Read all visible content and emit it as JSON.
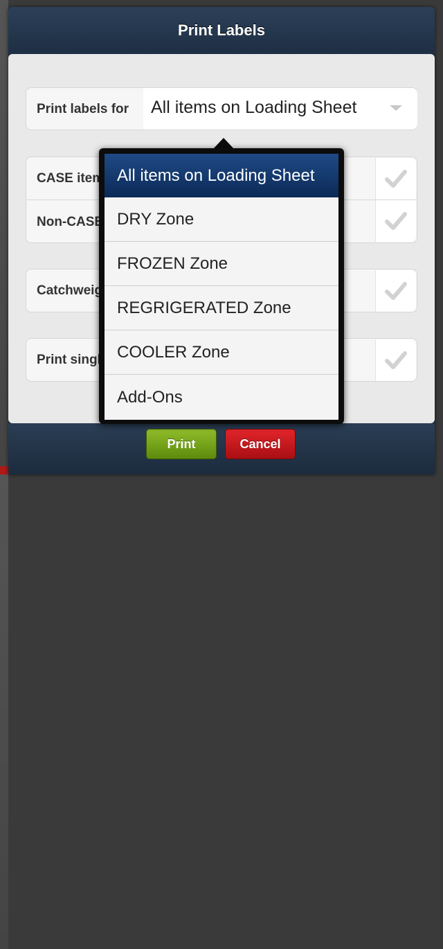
{
  "dialog": {
    "title": "Print Labels"
  },
  "print_for": {
    "label": "Print labels for",
    "value": "All items on Loading Sheet"
  },
  "options": {
    "case_items_label": "CASE item",
    "non_case_label": "Non-CASE",
    "catchweight_label": "Catchweig",
    "print_single_label": "Print singl"
  },
  "dropdown": {
    "items": [
      "All items on Loading Sheet",
      "DRY Zone",
      "FROZEN Zone",
      "REGRIGERATED Zone",
      "COOLER Zone",
      "Add-Ons"
    ],
    "selected_index": 0
  },
  "buttons": {
    "print": "Print",
    "cancel": "Cancel"
  },
  "colors": {
    "header": "#1e2f44",
    "selected_item": "#0b2a56",
    "print_button": "#6a9a12",
    "cancel_button": "#c0161b"
  }
}
